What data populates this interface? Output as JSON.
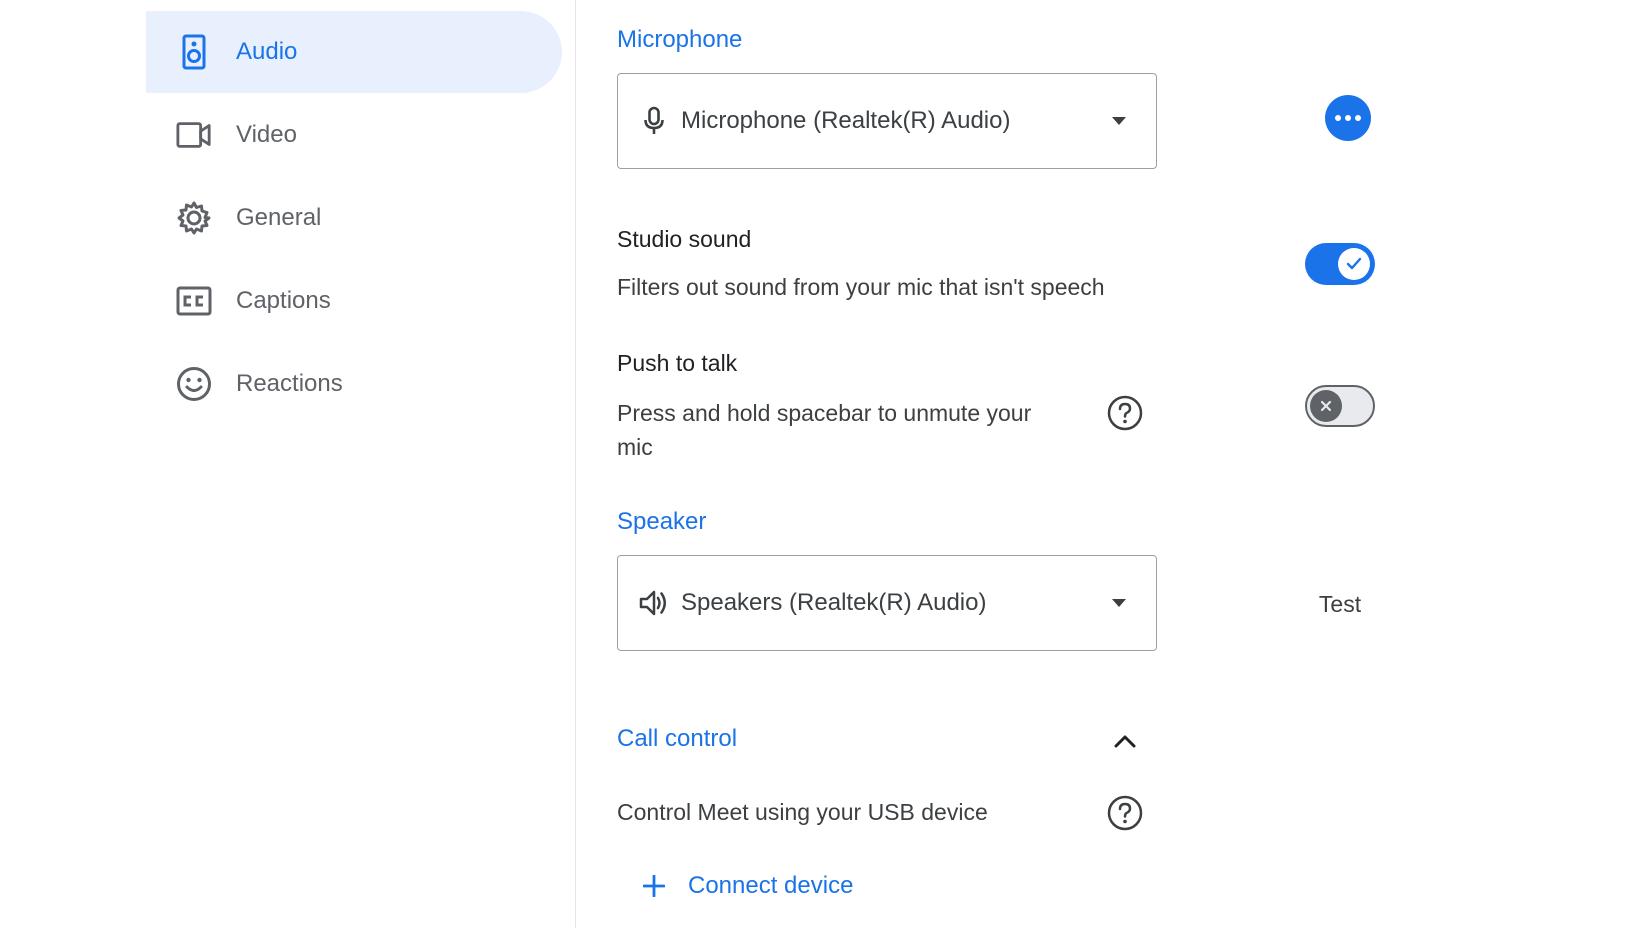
{
  "sidebar": {
    "items": [
      {
        "label": "Audio",
        "icon": "speaker-icon",
        "active": true
      },
      {
        "label": "Video",
        "icon": "video-camera-icon",
        "active": false
      },
      {
        "label": "General",
        "icon": "gear-icon",
        "active": false
      },
      {
        "label": "Captions",
        "icon": "closed-captions-icon",
        "active": false
      },
      {
        "label": "Reactions",
        "icon": "smiley-icon",
        "active": false
      }
    ]
  },
  "microphone": {
    "title": "Microphone",
    "selected": "Microphone (Realtek(R) Audio)",
    "more_icon": "more-horizontal-icon"
  },
  "studio_sound": {
    "title": "Studio sound",
    "description": "Filters out sound from your mic that isn't speech",
    "enabled": true
  },
  "push_to_talk": {
    "title": "Push to talk",
    "description_line1": "Press and hold spacebar to unmute your",
    "description_line2": "mic",
    "enabled": false
  },
  "speaker": {
    "title": "Speaker",
    "selected": "Speakers (Realtek(R) Audio)",
    "test_label": "Test"
  },
  "call_control": {
    "title": "Call control",
    "description": "Control Meet using your USB device",
    "connect_label": "Connect device",
    "expanded": true
  },
  "colors": {
    "accent": "#1a73e8",
    "active_bg": "#e8f0fe",
    "muted_text": "#5f6368"
  }
}
